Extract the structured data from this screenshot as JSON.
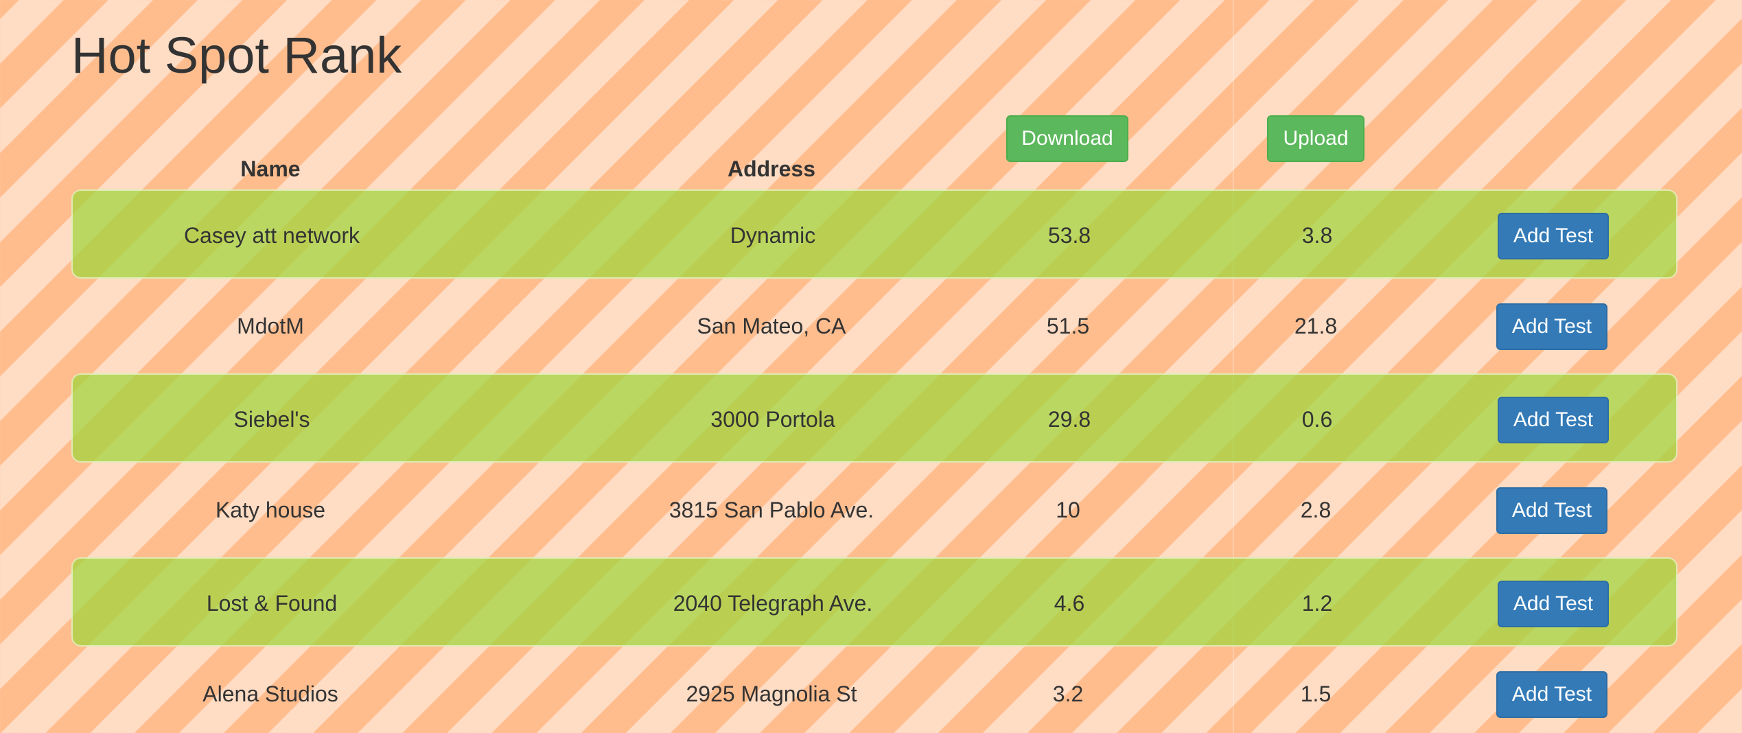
{
  "page": {
    "title": "Hot Spot Rank"
  },
  "table": {
    "headers": {
      "name": "Name",
      "address": "Address",
      "download": "Download",
      "upload": "Upload"
    },
    "action_label": "Add Test",
    "rows": [
      {
        "name": "Casey att network",
        "address": "Dynamic",
        "download": "53.8",
        "upload": "3.8",
        "highlighted": true
      },
      {
        "name": "MdotM",
        "address": "San Mateo, CA",
        "download": "51.5",
        "upload": "21.8",
        "highlighted": false
      },
      {
        "name": "Siebel's",
        "address": "3000 Portola",
        "download": "29.8",
        "upload": "0.6",
        "highlighted": true
      },
      {
        "name": "Katy house",
        "address": "3815 San Pablo Ave.",
        "download": "10",
        "upload": "2.8",
        "highlighted": false
      },
      {
        "name": "Lost & Found",
        "address": "2040 Telegraph Ave.",
        "download": "4.6",
        "upload": "1.2",
        "highlighted": true
      },
      {
        "name": "Alena Studios",
        "address": "2925 Magnolia St",
        "download": "3.2",
        "upload": "1.5",
        "highlighted": false
      }
    ]
  },
  "colors": {
    "stripe_light": "#ffdcc4",
    "stripe_dark": "#ffbd8e",
    "row_highlight": "#a0d63c",
    "button_green": "#5cb85c",
    "button_blue": "#337ab7"
  }
}
